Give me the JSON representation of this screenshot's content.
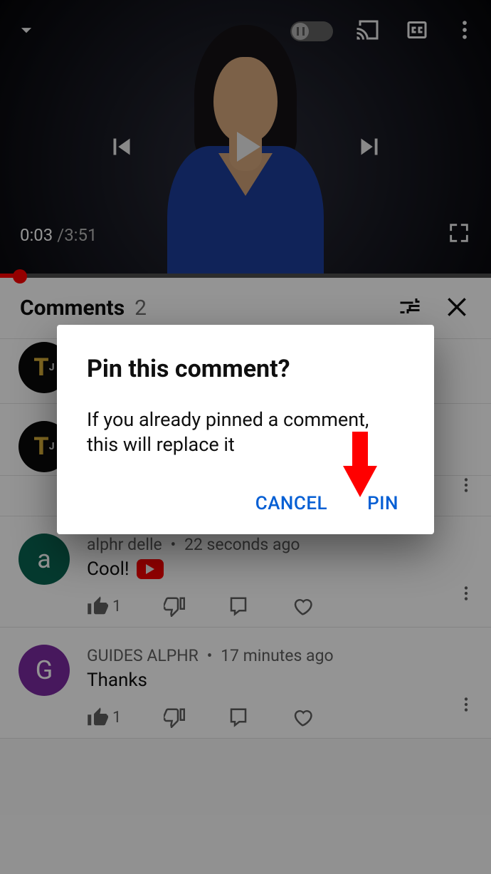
{
  "player": {
    "current_time": "0:03",
    "duration": "3:51"
  },
  "comments": {
    "title": "Comments",
    "count": "2",
    "items": [
      {
        "author": "alphr delle",
        "when": "22 seconds ago",
        "text": "Cool!",
        "likes": "1",
        "avatar_initial": "a",
        "avatar_style": "a"
      },
      {
        "author": "GUIDES ALPHR",
        "when": "17 minutes ago",
        "text": "Thanks",
        "likes": "1",
        "avatar_initial": "G",
        "avatar_style": "g"
      }
    ],
    "partial_avatar_initial": "T"
  },
  "dialog": {
    "title": "Pin this comment?",
    "body": "If you already pinned a comment, this will replace it",
    "cancel": "CANCEL",
    "confirm": "PIN"
  },
  "colors": {
    "accent_blue": "#065fd4",
    "yt_red": "#ff0000"
  }
}
